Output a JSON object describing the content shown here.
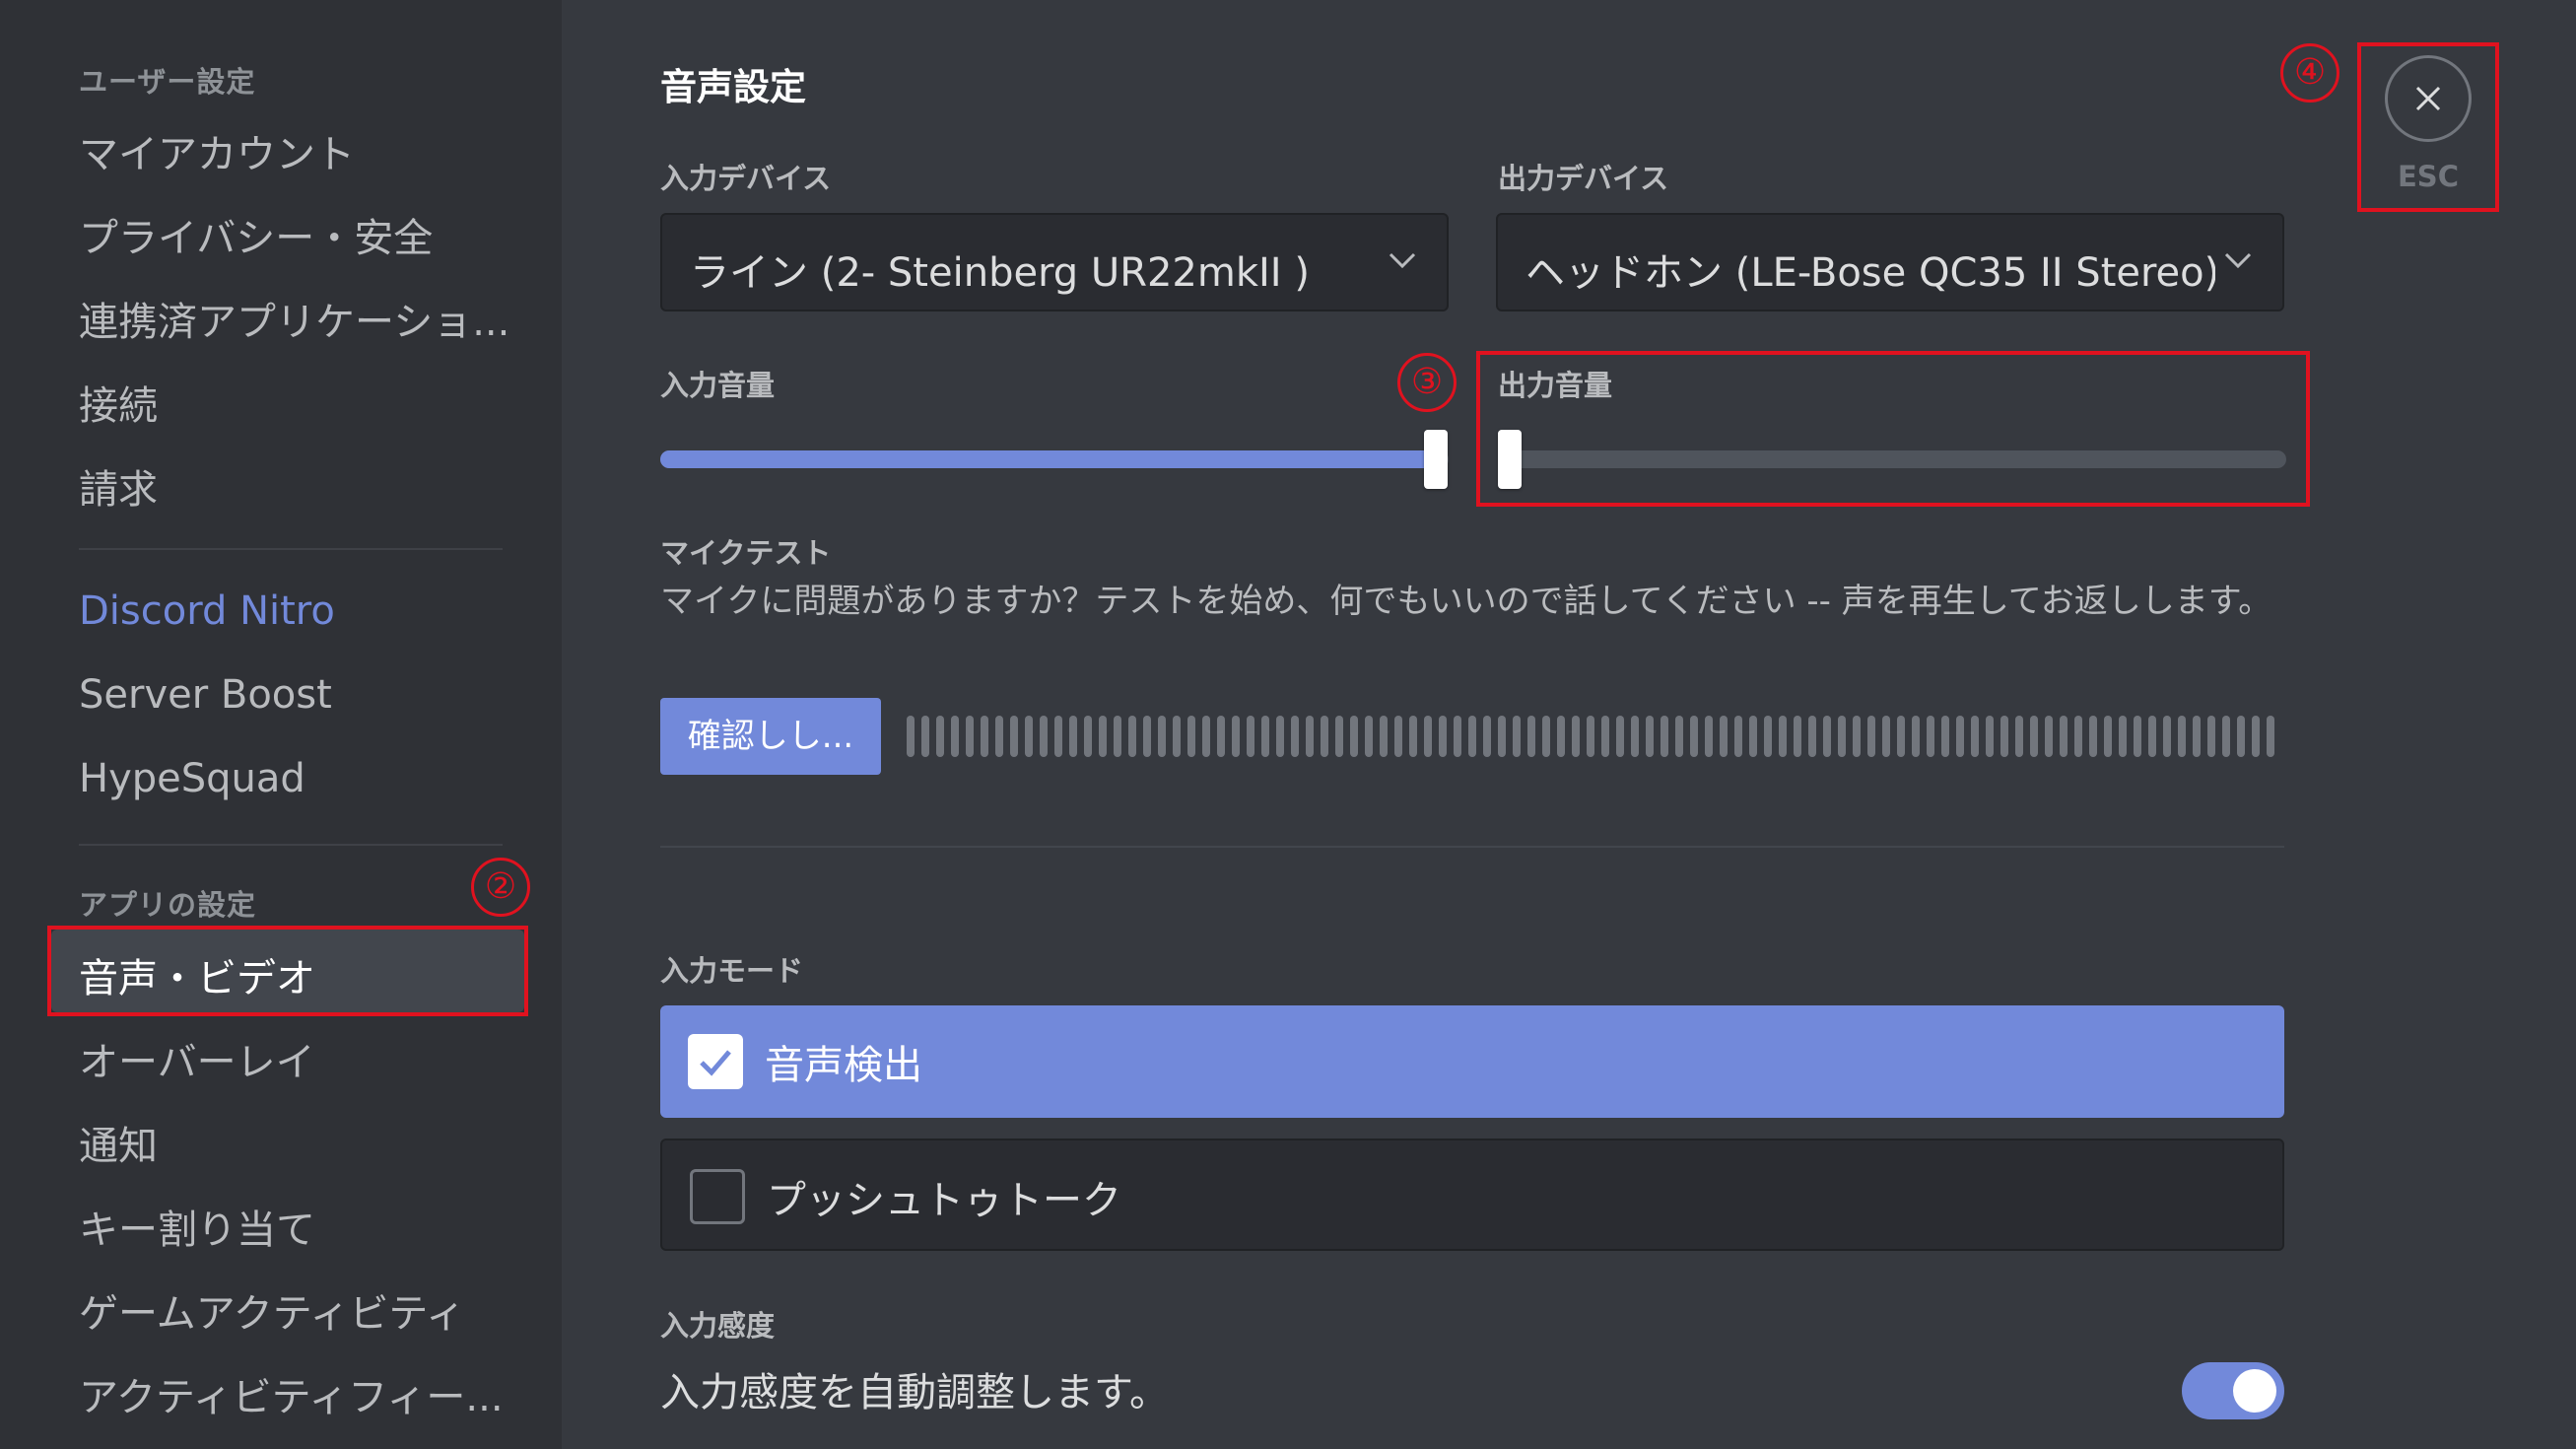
{
  "sidebar": {
    "user_settings_header": "ユーザー設定",
    "user_items": [
      "マイアカウント",
      "プライバシー・安全",
      "連携済アプリケーショ...",
      "接続",
      "請求"
    ],
    "nitro_items": [
      "Discord Nitro",
      "Server Boost",
      "HypeSquad"
    ],
    "app_settings_header": "アプリの設定",
    "app_items": [
      "音声・ビデオ",
      "オーバーレイ",
      "通知",
      "キー割り当て",
      "ゲームアクティビティ",
      "アクティビティフィー..."
    ],
    "active_item": "音声・ビデオ"
  },
  "annotations": [
    "②",
    "③",
    "④"
  ],
  "main": {
    "title": "音声設定",
    "input_device_label": "入力デバイス",
    "input_device_value": "ライン (2- Steinberg UR22mkII )",
    "output_device_label": "出力デバイス",
    "output_device_value": "ヘッドホン (LE-Bose QC35 II Stereo)",
    "input_volume_label": "入力音量",
    "input_volume_level_percent": 100,
    "output_volume_label": "出力音量",
    "output_volume_level_percent": 0,
    "mic_test_label": "マイクテスト",
    "mic_test_desc": "マイクに問題がありますか？テストを始め、何でもいいので話してください -- 声を再生してお返しします。",
    "mic_test_button": "確認しし...",
    "input_mode_label": "入力モード",
    "modes": [
      {
        "label": "音声検出",
        "checked": true
      },
      {
        "label": "プッシュトゥトーク",
        "checked": false
      }
    ],
    "sensitivity_label": "入力感度",
    "sensitivity_auto_text": "入力感度を自動調整します。",
    "sensitivity_auto_enabled": true,
    "close_label": "ESC"
  },
  "colors": {
    "accent": "#7289da",
    "sidebar_bg": "#2f3136",
    "main_bg": "#36393f",
    "annotation_red": "#e0121f"
  }
}
